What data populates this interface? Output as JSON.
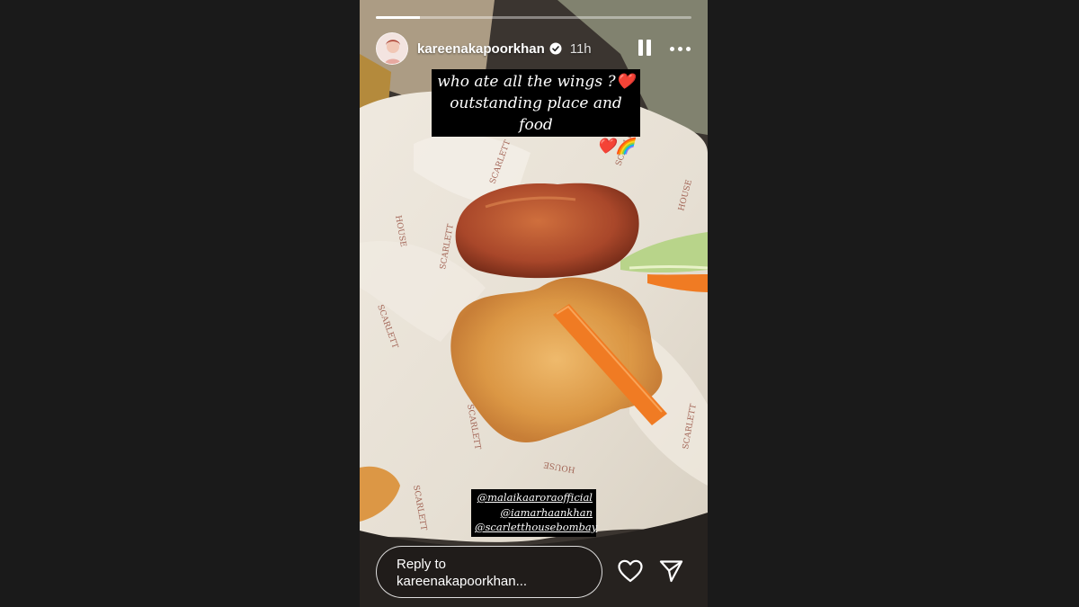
{
  "story": {
    "progress": 0.14,
    "username": "kareenakapoorkhan",
    "verified": true,
    "time_ago": "11h",
    "caption": {
      "line1": "who ate all the wings ?❤️",
      "line2": "outstanding place and food",
      "line3": "❤️🌈"
    },
    "mentions": [
      "@malaikaaroraofficial",
      "@iamarhaankhan",
      "@scarletthousebombay"
    ],
    "reply_placeholder_line1": "Reply to",
    "reply_placeholder_line2": "kareenakapoorkhan...",
    "icons": {
      "pause": "pause-icon",
      "more": "more-options-icon",
      "like": "heart-icon",
      "share": "send-icon",
      "verified": "verified-badge-icon"
    },
    "colors": {
      "background": "#1a1a1a",
      "caption_bg": "#000000",
      "sauce": "#d98a2b",
      "wing": "#b5532c",
      "carrot": "#f07b23",
      "paper": "#ebe5db"
    },
    "paper_print": [
      "SCARLETT HOUSE",
      "SCARLETT HOUSE",
      "SCARLETT HOUSE",
      "SCARLETT HOUSE",
      "SCARLETT HOUSE",
      "SCARLETT HOUSE",
      "SCARLETT HOUSE",
      "SCARLETT HOUSE",
      "SCARLETT HOUSE",
      "SCARLETT HOUSE"
    ]
  }
}
